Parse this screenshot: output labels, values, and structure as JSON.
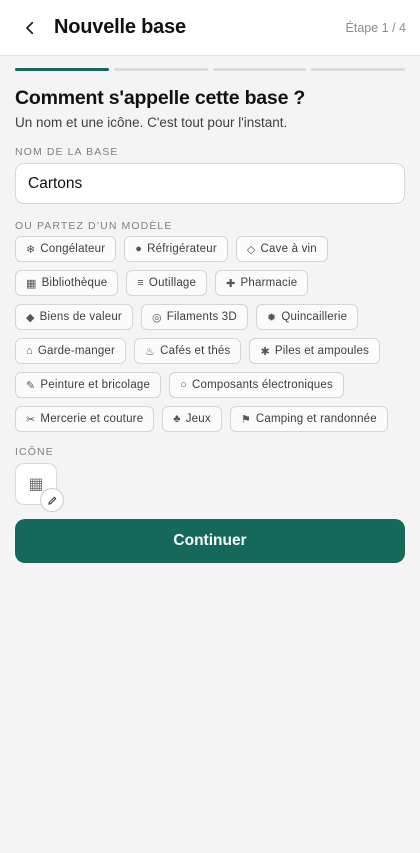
{
  "header": {
    "title": "Nouvelle base",
    "step": "Étape 1 / 4",
    "back_icon": "chevron-left-icon"
  },
  "progress": {
    "current_step": 1,
    "total_steps": 4,
    "active_color": "#14695a"
  },
  "question": {
    "title": "Comment s'appelle cette base ?",
    "subtitle": "Un nom et une icône. C'est tout pour l'instant."
  },
  "name_field": {
    "label": "NOM DE LA BASE",
    "value": "Cartons"
  },
  "templates": {
    "label": "OU PARTEZ D’UN MODÈLE",
    "rows": [
      [
        {
          "icon": "❄",
          "label": "Congélateur"
        },
        {
          "icon": "●",
          "label": "Réfrigérateur"
        },
        {
          "icon": "◇",
          "label": "Cave à vin"
        }
      ],
      [
        {
          "icon": "▦",
          "label": "Bibliothèque"
        },
        {
          "icon": "≡",
          "label": "Outillage"
        },
        {
          "icon": "✚",
          "label": "Pharmacie"
        }
      ],
      [
        {
          "icon": "◆",
          "label": "Biens de valeur"
        },
        {
          "icon": "◎",
          "label": "Filaments 3D"
        },
        {
          "icon": "✹",
          "label": "Quincaillerie"
        }
      ],
      [
        {
          "icon": "⌂",
          "label": "Garde-manger"
        },
        {
          "icon": "♨",
          "label": "Cafés et thés"
        },
        {
          "icon": "✱",
          "label": "Piles et ampoules"
        }
      ],
      [
        {
          "icon": "✎",
          "label": "Peinture et bricolage"
        },
        {
          "icon": "○",
          "label": "Composants électroniques"
        }
      ],
      [
        {
          "icon": "✂",
          "label": "Mercerie et couture"
        },
        {
          "icon": "♣",
          "label": "Jeux"
        },
        {
          "icon": "⚑",
          "label": "Camping et randonnée"
        }
      ]
    ]
  },
  "icon_picker": {
    "label": "ICÔNE",
    "current_icon": "▦",
    "edit_icon": "pencil-icon"
  },
  "continue_button": {
    "label": "Continuer",
    "color": "#14695a"
  }
}
